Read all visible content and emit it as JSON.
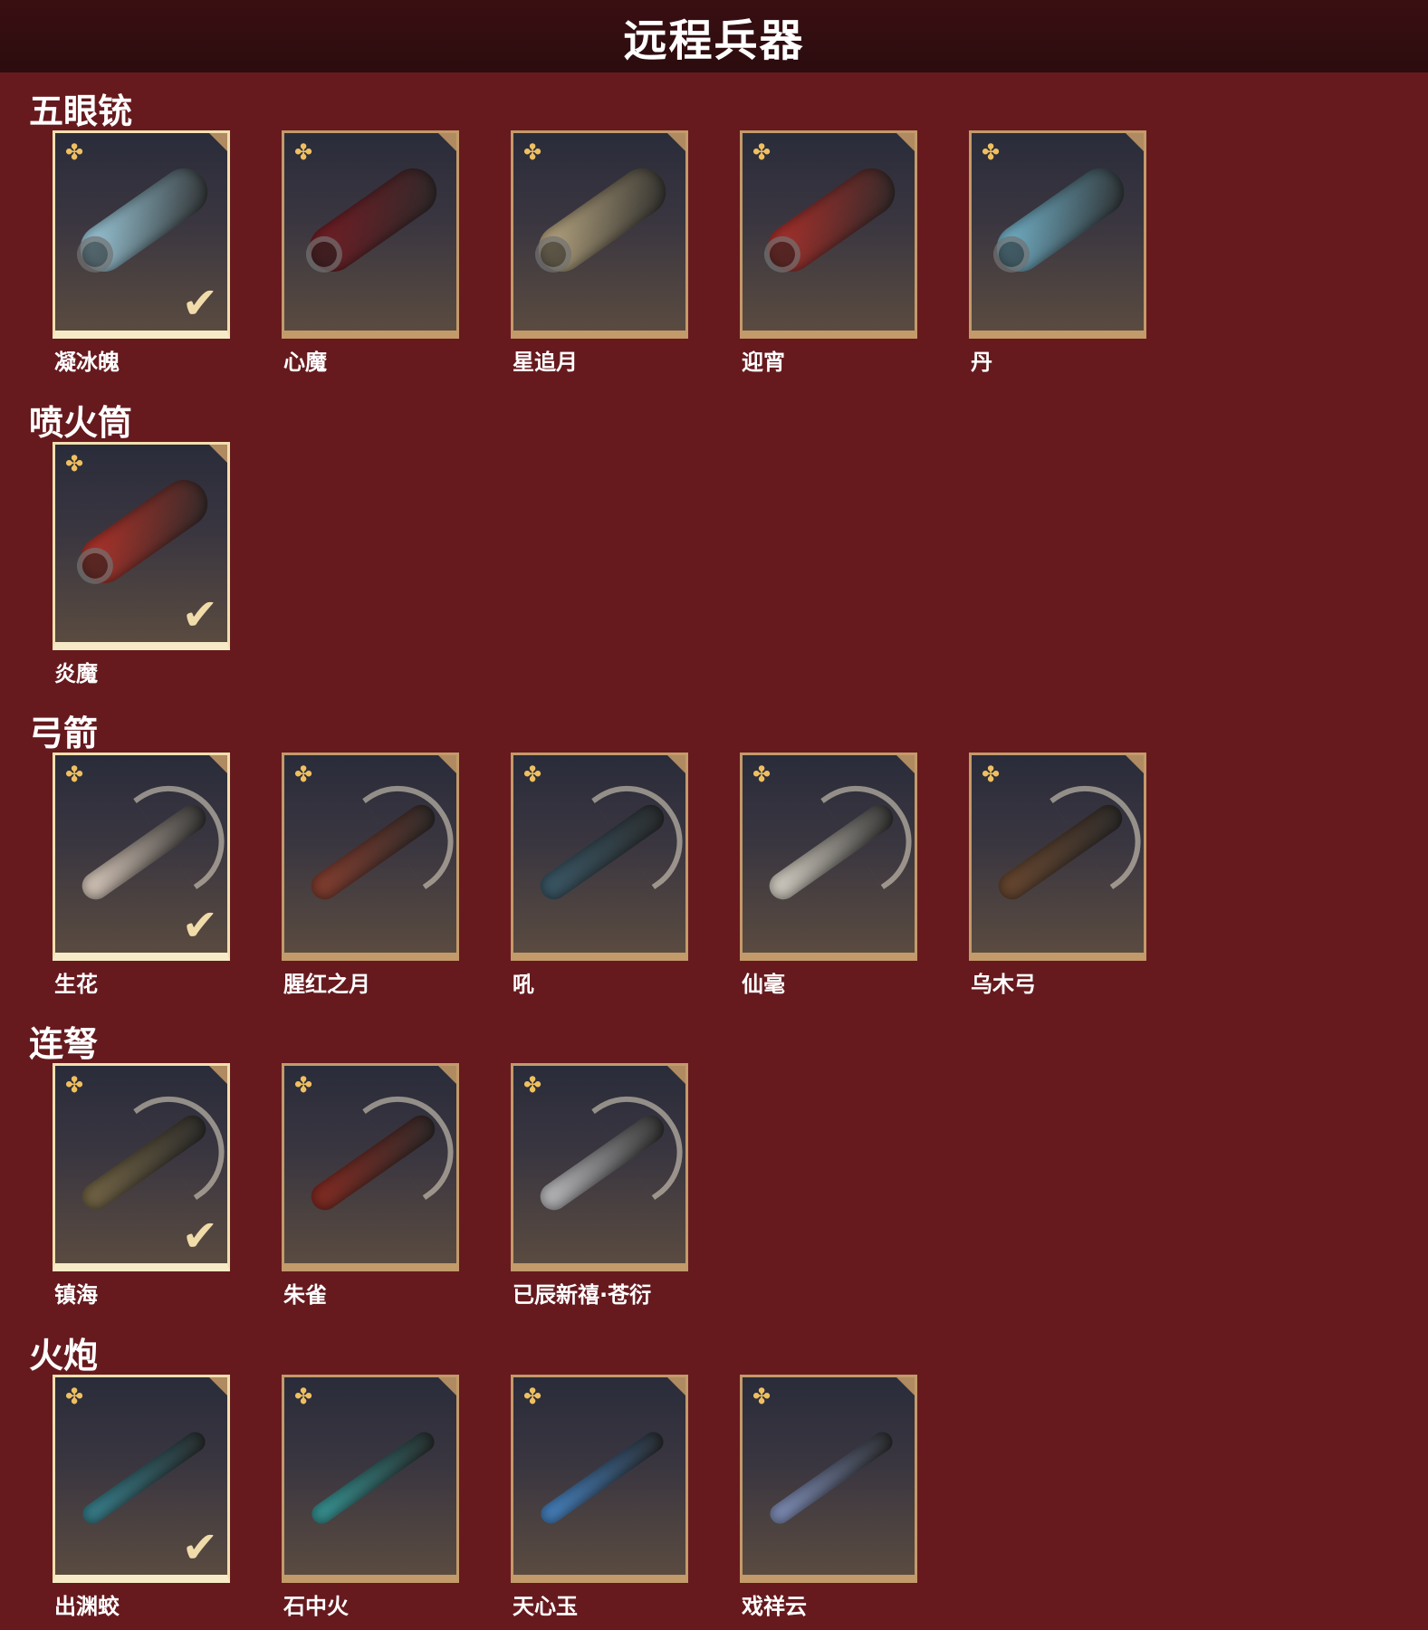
{
  "title": "远程兵器",
  "sections": [
    {
      "name": "五眼铳",
      "items": [
        {
          "name": "凝冰魄",
          "selected": true,
          "color": "#a9dcef"
        },
        {
          "name": "心魔",
          "selected": false,
          "color": "#7a1c24"
        },
        {
          "name": "星追月",
          "selected": false,
          "color": "#c6b38a"
        },
        {
          "name": "迎宵",
          "selected": false,
          "color": "#b8312c"
        },
        {
          "name": "丹",
          "selected": false,
          "color": "#7cc2dc"
        }
      ]
    },
    {
      "name": "喷火筒",
      "items": [
        {
          "name": "炎魔",
          "selected": true,
          "color": "#c0342a"
        }
      ]
    },
    {
      "name": "弓箭",
      "items": [
        {
          "name": "生花",
          "selected": true,
          "color": "#e7d6c8"
        },
        {
          "name": "腥红之月",
          "selected": false,
          "color": "#8c4030"
        },
        {
          "name": "吼",
          "selected": false,
          "color": "#3c5c6c"
        },
        {
          "name": "仙毫",
          "selected": false,
          "color": "#e6e0d4"
        },
        {
          "name": "乌木弓",
          "selected": false,
          "color": "#6e4a30"
        }
      ]
    },
    {
      "name": "连弩",
      "items": [
        {
          "name": "镇海",
          "selected": true,
          "color": "#7a6a48"
        },
        {
          "name": "朱雀",
          "selected": false,
          "color": "#8c2c22"
        },
        {
          "name": "已辰新禧·苍衍",
          "selected": false,
          "color": "#c8c8cc"
        }
      ]
    },
    {
      "name": "火炮",
      "items": [
        {
          "name": "出渊蛟",
          "selected": true,
          "color": "#3a8a98"
        },
        {
          "name": "石中火",
          "selected": false,
          "color": "#3aa0a0"
        },
        {
          "name": "天心玉",
          "selected": false,
          "color": "#4a8cd0"
        },
        {
          "name": "戏祥云",
          "selected": false,
          "color": "#8a9ac8"
        }
      ]
    }
  ],
  "icons": {
    "rarity": "flower-icon",
    "check": "checkmark-icon",
    "corner": "corner-tab-icon"
  }
}
